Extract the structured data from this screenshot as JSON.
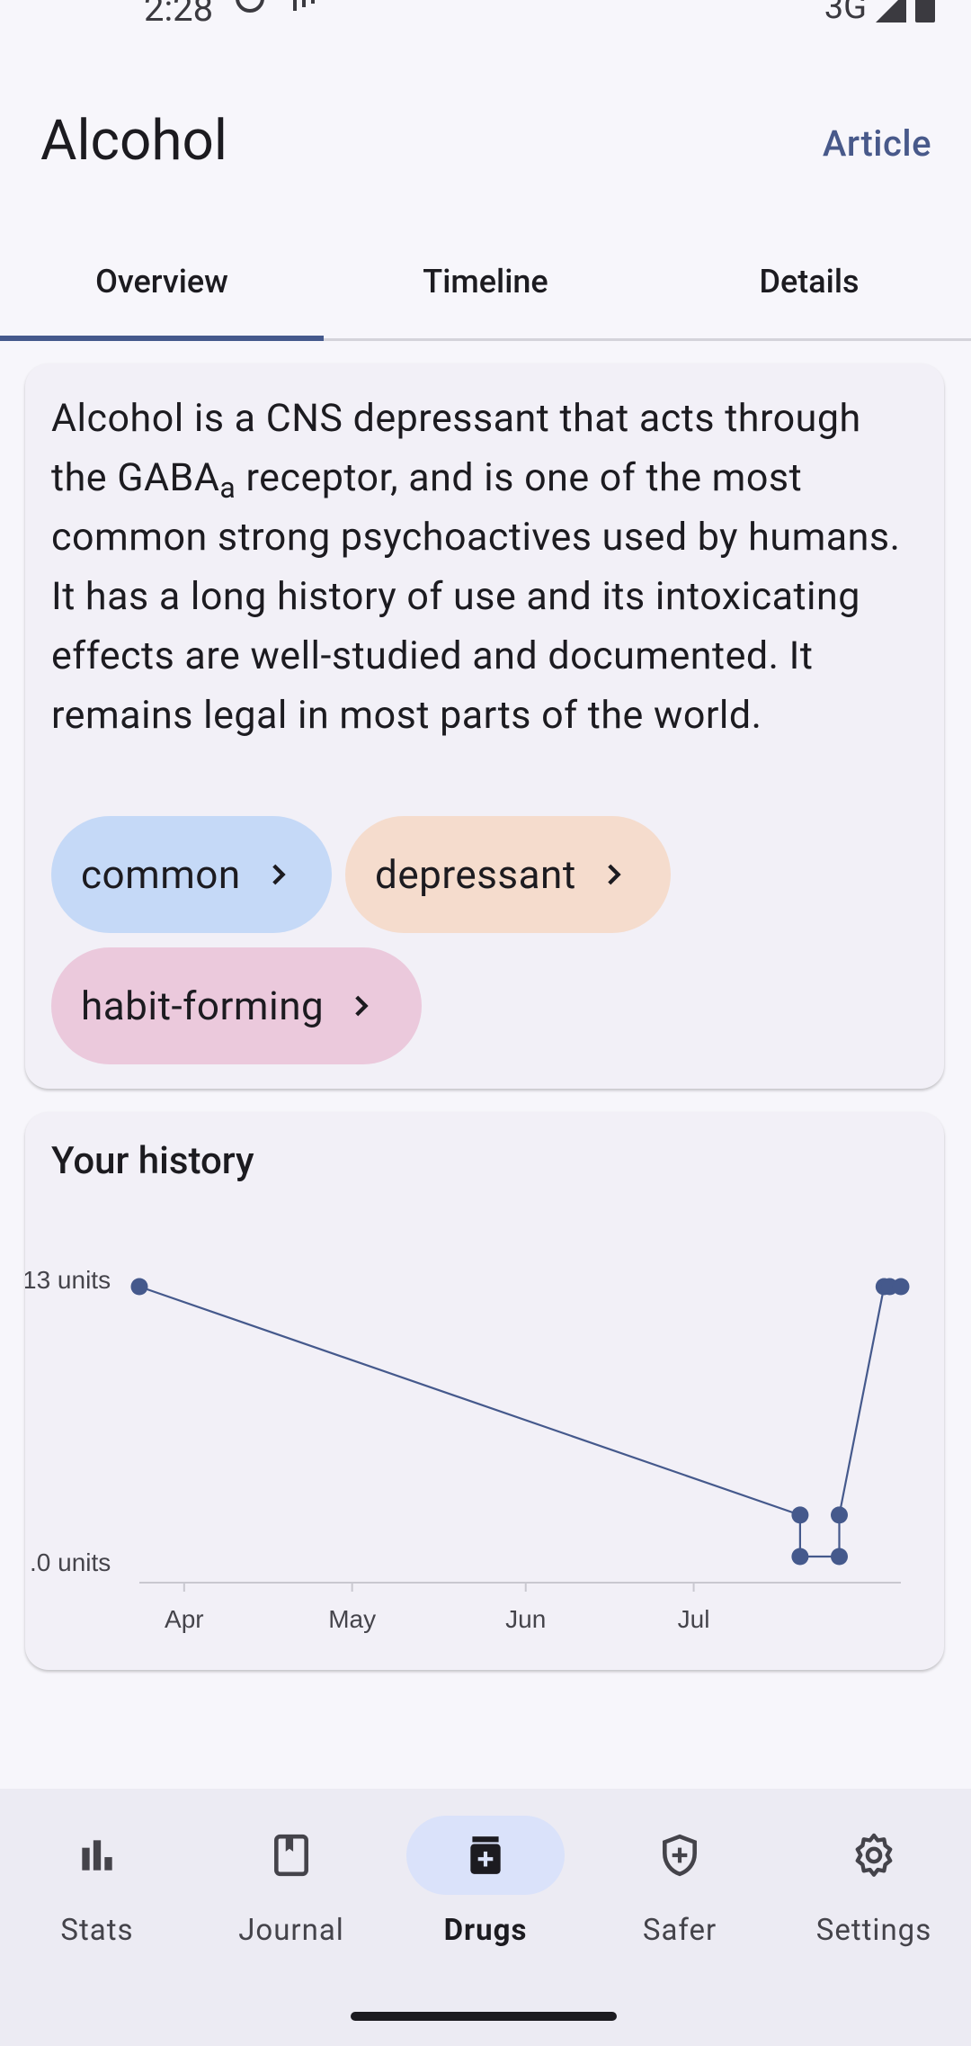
{
  "status": {
    "time": "2:28",
    "network": "3G"
  },
  "appbar": {
    "title": "Alcohol",
    "article_label": "Article"
  },
  "tabs": [
    {
      "label": "Overview",
      "selected": true
    },
    {
      "label": "Timeline",
      "selected": false
    },
    {
      "label": "Details",
      "selected": false
    }
  ],
  "overview": {
    "desc_part1": "Alcohol is a CNS depressant that acts through the GABA",
    "desc_sub": "a",
    "desc_part2": " receptor, and is one of the most common strong psychoactives used by humans. It has a long history of use and its intoxicating effects are well-studied and documented. It remains legal in most parts of the world.",
    "chips": [
      {
        "label": "common",
        "color": "#c5d9f7"
      },
      {
        "label": "depressant",
        "color": "#f5dccd"
      },
      {
        "label": "habit-forming",
        "color": "#ebc9dc"
      }
    ]
  },
  "history": {
    "title": "Your history"
  },
  "chart_data": {
    "type": "line",
    "y_tick_labels": [
      "13 units",
      ".0 units"
    ],
    "x_tick_labels": [
      "Apr",
      "May",
      "Jun",
      "Jul"
    ],
    "ylim": [
      0,
      13
    ],
    "line_color": "#45598c",
    "points": [
      {
        "x": "Mar 24",
        "y": 13
      },
      {
        "x": "Jul 20",
        "y": 2
      },
      {
        "x": "Jul 20",
        "y": 0
      },
      {
        "x": "Jul 27",
        "y": 0
      },
      {
        "x": "Jul 27",
        "y": 2
      },
      {
        "x": "Aug 4",
        "y": 13
      },
      {
        "x": "Aug 5",
        "y": 13
      },
      {
        "x": "Aug 7",
        "y": 13
      }
    ]
  },
  "nav": {
    "items": [
      {
        "label": "Stats",
        "icon": "bar-chart-icon",
        "active": false
      },
      {
        "label": "Journal",
        "icon": "book-icon",
        "active": false
      },
      {
        "label": "Drugs",
        "icon": "medication-icon",
        "active": true
      },
      {
        "label": "Safer",
        "icon": "shield-plus-icon",
        "active": false
      },
      {
        "label": "Settings",
        "icon": "gear-icon",
        "active": false
      }
    ]
  }
}
